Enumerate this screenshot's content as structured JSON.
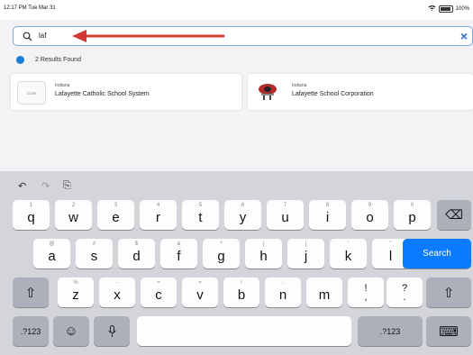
{
  "status": {
    "time": "12:17 PM  Tue Mar 31",
    "battery": "100%"
  },
  "search": {
    "query": "laf",
    "clear_icon": "×"
  },
  "results_summary": "2 Results Found",
  "results": [
    {
      "state": "Indiana",
      "name": "Lafayette Catholic School System",
      "logo_text": "LCSS"
    },
    {
      "state": "Indiana",
      "name": "Lafayette School Corporation",
      "logo_text": ""
    }
  ],
  "keyboard": {
    "toolbar": {
      "undo_icon": "↶",
      "redo_icon": "↷",
      "paste_icon": "⎘"
    },
    "row1": [
      {
        "hint": "1",
        "key": "q"
      },
      {
        "hint": "2",
        "key": "w"
      },
      {
        "hint": "3",
        "key": "e"
      },
      {
        "hint": "4",
        "key": "r"
      },
      {
        "hint": "5",
        "key": "t"
      },
      {
        "hint": "6",
        "key": "y"
      },
      {
        "hint": "7",
        "key": "u"
      },
      {
        "hint": "8",
        "key": "i"
      },
      {
        "hint": "9",
        "key": "o"
      },
      {
        "hint": "0",
        "key": "p"
      }
    ],
    "row2": [
      {
        "hint": "@",
        "key": "a"
      },
      {
        "hint": "#",
        "key": "s"
      },
      {
        "hint": "$",
        "key": "d"
      },
      {
        "hint": "&",
        "key": "f"
      },
      {
        "hint": "*",
        "key": "g"
      },
      {
        "hint": "(",
        "key": "h"
      },
      {
        "hint": ")",
        "key": "j"
      },
      {
        "hint": "’",
        "key": "k"
      },
      {
        "hint": "\"",
        "key": "l"
      }
    ],
    "row3": [
      {
        "hint": "%",
        "key": "z"
      },
      {
        "hint": "-",
        "key": "x"
      },
      {
        "hint": "+",
        "key": "c"
      },
      {
        "hint": "=",
        "key": "v"
      },
      {
        "hint": "/",
        "key": "b"
      },
      {
        "hint": ";",
        "key": "n"
      },
      {
        "hint": ":",
        "key": "m"
      }
    ],
    "exclaim": {
      "top": "!",
      "bottom": ","
    },
    "question": {
      "top": "?",
      "bottom": "."
    },
    "search_label": "Search",
    "shift_icon": "⇧",
    "numbers_label": ".?123",
    "emoji_icon": "☺",
    "mic_icon": "🎙",
    "hide_icon": "⌨",
    "delete_icon": "⌫"
  }
}
